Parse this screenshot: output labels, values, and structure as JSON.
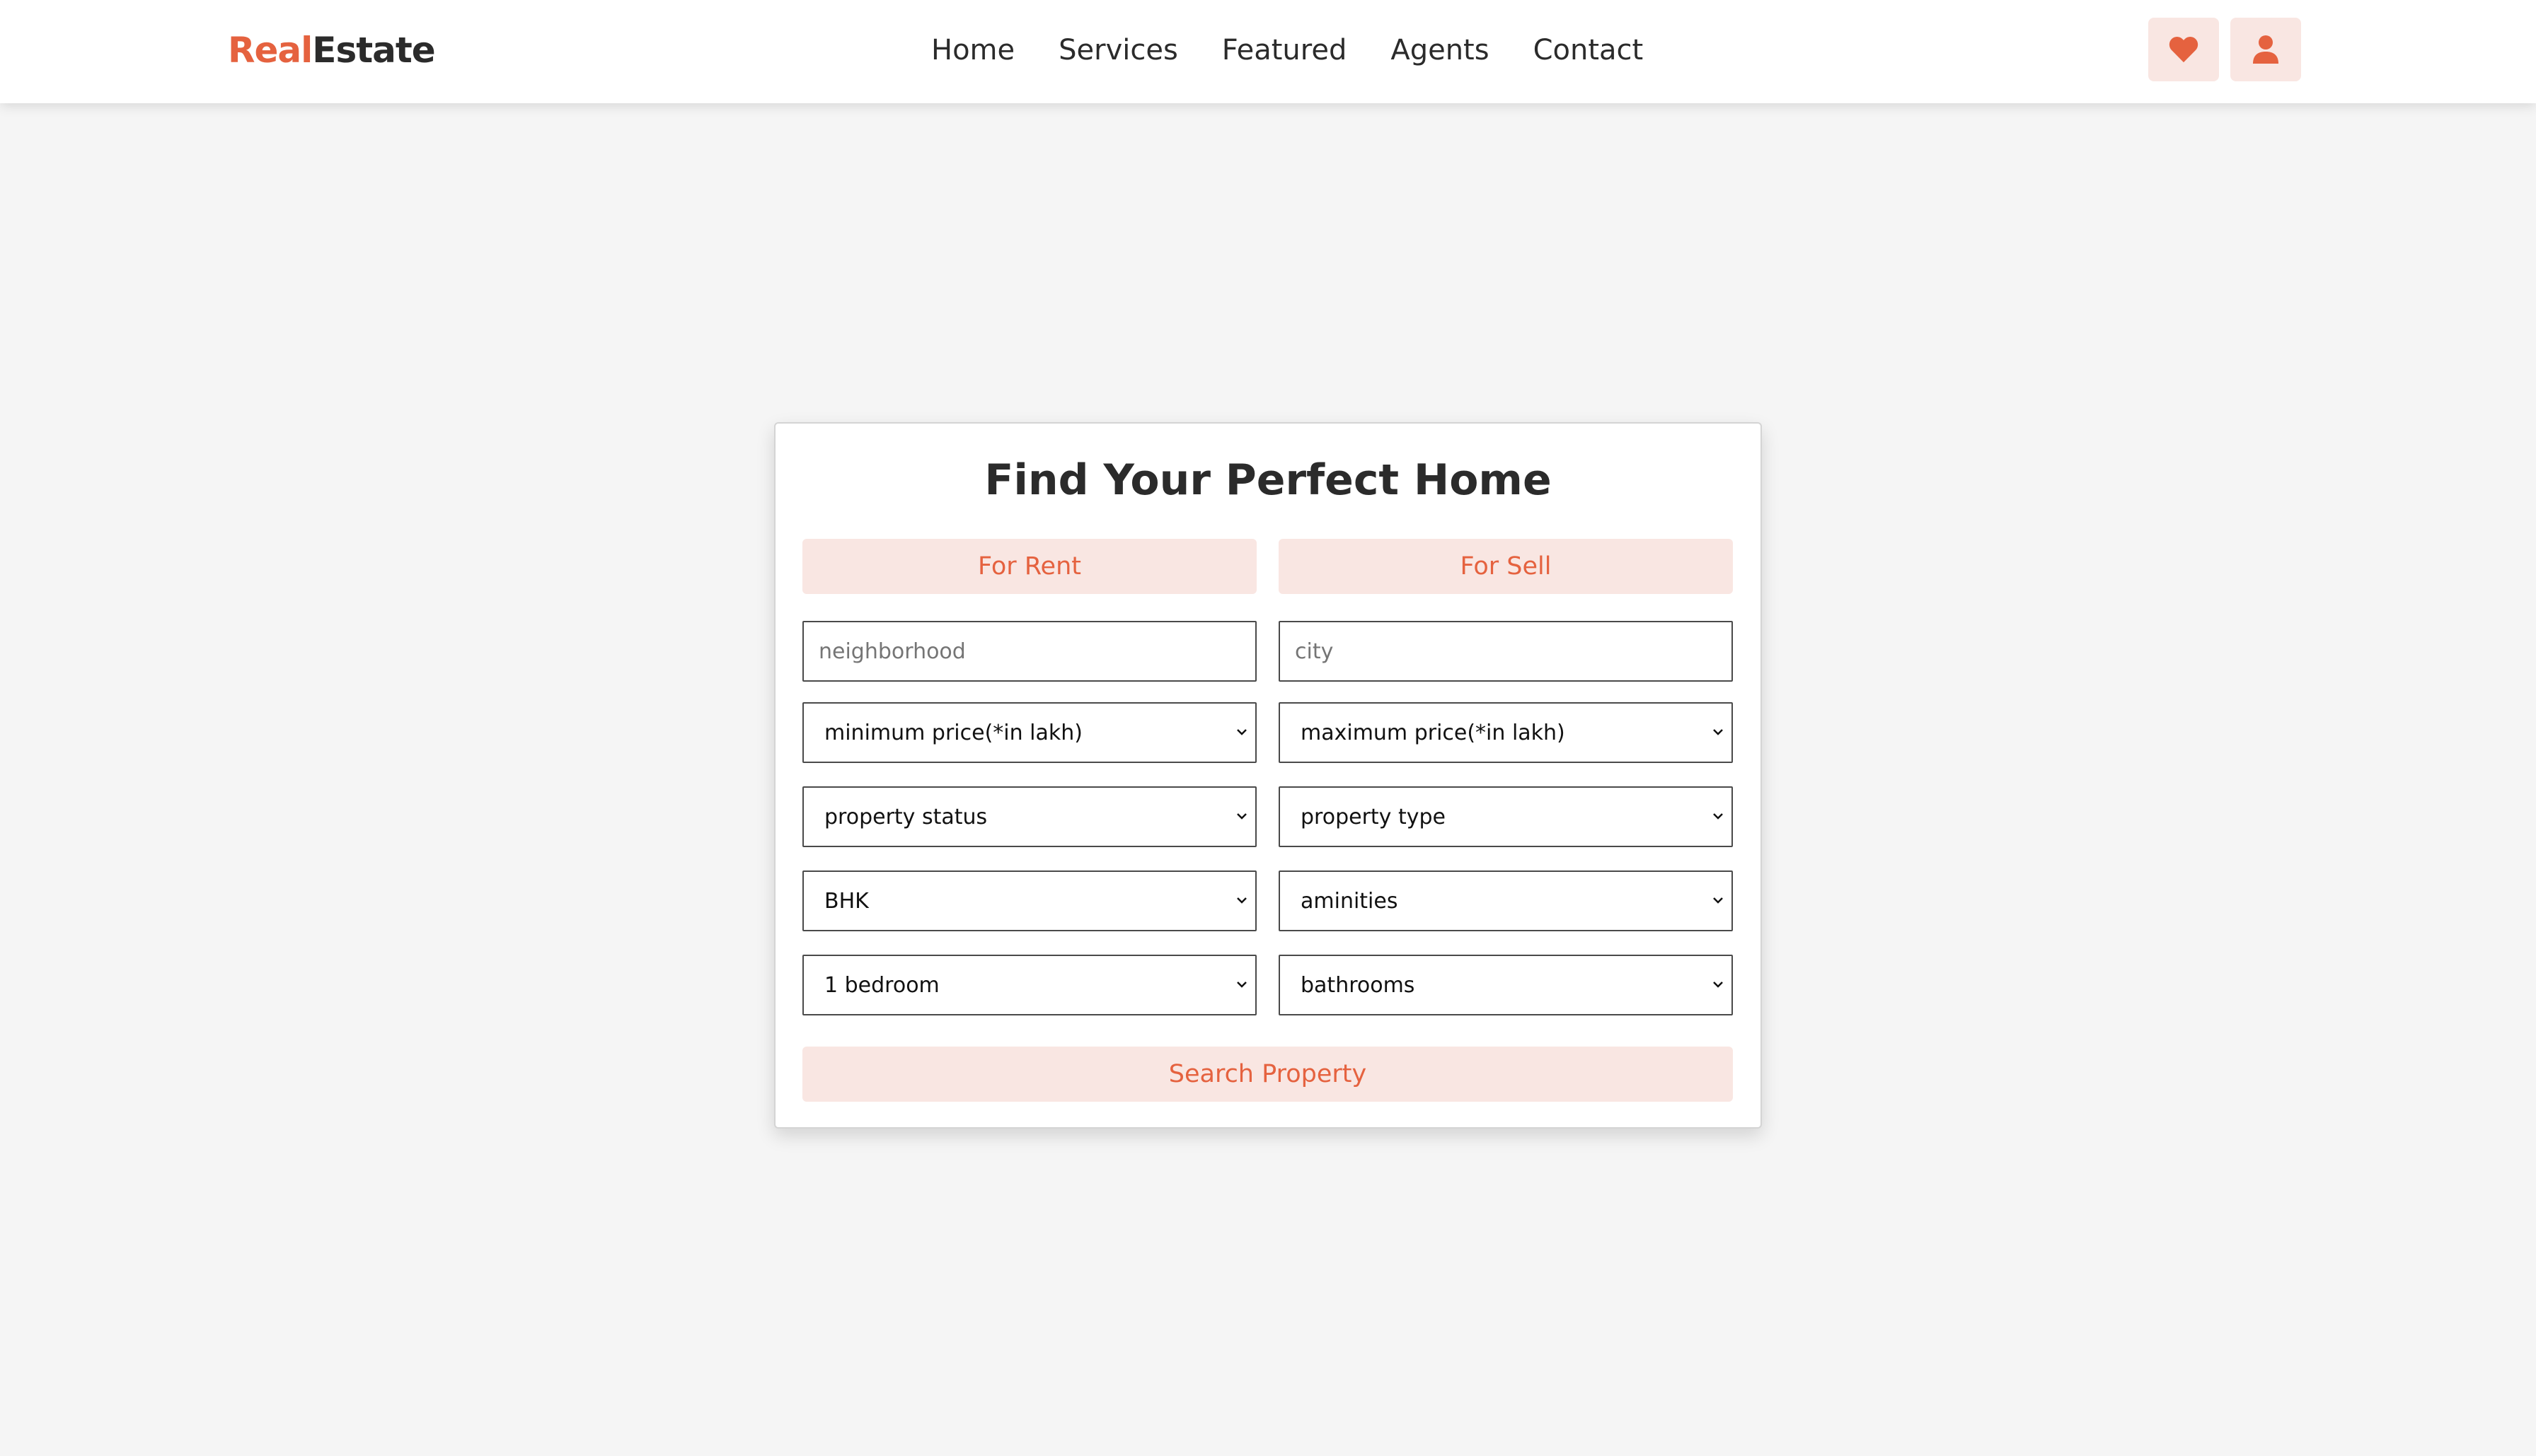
{
  "brand": {
    "accent_text": "Real",
    "rest_text": "Estate",
    "accent_color": "#e5623f"
  },
  "nav": {
    "items": [
      {
        "label": "Home"
      },
      {
        "label": "Services"
      },
      {
        "label": "Featured"
      },
      {
        "label": "Agents"
      },
      {
        "label": "Contact"
      }
    ]
  },
  "header_icons": [
    "heart-icon",
    "user-icon"
  ],
  "search": {
    "title": "Find Your Perfect Home",
    "tabs": {
      "rent_label": "For Rent",
      "sell_label": "For Sell"
    },
    "neighborhood_placeholder": "neighborhood",
    "city_placeholder": "city",
    "selects": {
      "min_price": "minimum price(*in lakh)",
      "max_price": "maximum price(*in lakh)",
      "property_status": "property status",
      "property_type": "property type",
      "bhk": "BHK",
      "amenities": "aminities",
      "bedrooms": "1 bedroom",
      "bathrooms": "bathrooms"
    },
    "submit_label": "Search Property"
  },
  "colors": {
    "accent": "#e5623f",
    "accent_bg": "#f9e6e2",
    "page_bg": "#f5f5f5"
  }
}
